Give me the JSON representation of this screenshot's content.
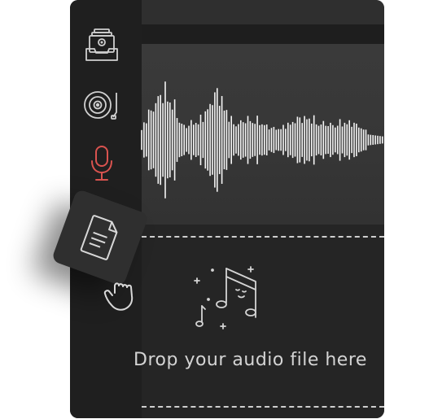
{
  "sidebar": {
    "items": [
      {
        "name": "inbox-icon",
        "color": "#d0d0d0"
      },
      {
        "name": "vinyl-record-icon",
        "color": "#d0d0d0"
      },
      {
        "name": "microphone-icon",
        "color": "#d9534f"
      }
    ]
  },
  "drag": {
    "file_icon": "document-icon",
    "hand_icon": "grab-hand-icon"
  },
  "drop_zone": {
    "icon": "music-notes-icon",
    "label": "Drop your audio file here"
  },
  "colors": {
    "panel": "#2b2b2b",
    "sidebar": "#1f1f1f",
    "waveform": "#f5f5f5",
    "accent_red": "#d9534f"
  }
}
